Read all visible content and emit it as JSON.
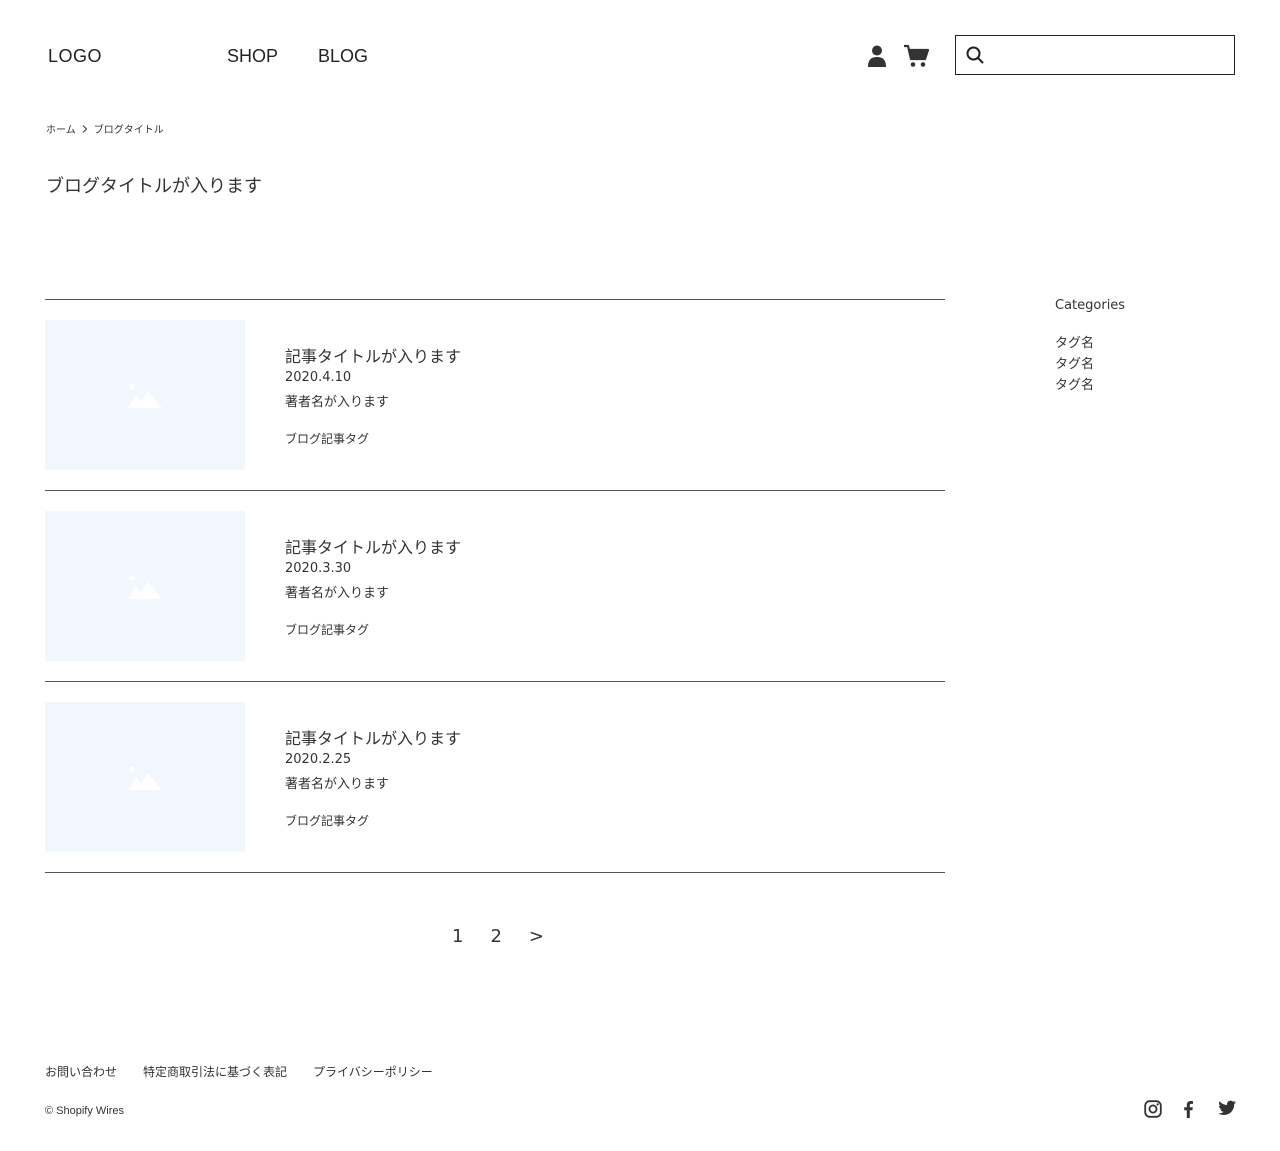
{
  "header": {
    "logo": "LOGO",
    "nav": [
      {
        "label": "SHOP"
      },
      {
        "label": "BLOG"
      }
    ],
    "search": {
      "value": "",
      "placeholder": ""
    },
    "icons": [
      "user-icon",
      "cart-icon",
      "search-icon"
    ]
  },
  "breadcrumb": {
    "home": "ホーム",
    "current": "ブログタイトル"
  },
  "page_title": "ブログタイトルが入ります",
  "articles": [
    {
      "title": "記事タイトルが入ります",
      "date": "2020.4.10",
      "author": "著者名が入ります",
      "tag": "ブログ記事タグ"
    },
    {
      "title": "記事タイトルが入ります",
      "date": "2020.3.30",
      "author": "著者名が入ります",
      "tag": "ブログ記事タグ"
    },
    {
      "title": "記事タイトルが入ります",
      "date": "2020.2.25",
      "author": "著者名が入ります",
      "tag": "ブログ記事タグ"
    }
  ],
  "pagination": {
    "pages": [
      "1",
      "2"
    ],
    "next": ">"
  },
  "sidebar": {
    "title": "Categories",
    "items": [
      "タグ名",
      "タグ名",
      "タグ名"
    ]
  },
  "footer": {
    "links": [
      "お問い合わせ",
      "特定商取引法に基づく表記",
      "プライバシーポリシー"
    ],
    "copyright": "© Shopify Wires",
    "social_icons": [
      "instagram-icon",
      "facebook-icon",
      "twitter-icon"
    ]
  },
  "colors": {
    "text": "#333333",
    "placeholder_bg": "#f1f7fd",
    "divider": "#555555"
  }
}
